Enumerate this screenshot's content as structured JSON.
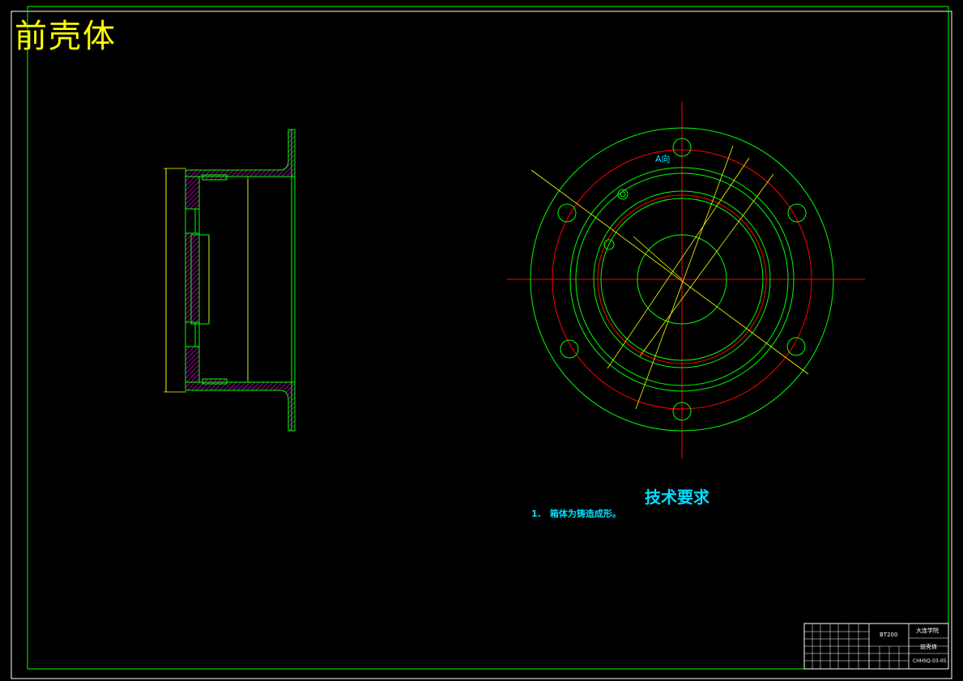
{
  "drawing_title": "前壳体",
  "view_label": "A向",
  "technical_requirements": {
    "title": "技术要求",
    "items": [
      "1.　箱体为铸造成形。"
    ]
  },
  "title_block": {
    "school": "大连学院",
    "part_name": "前壳体",
    "model": "BT200",
    "drawing_no": "CHHSQ-03-05"
  },
  "colors": {
    "background": "#000000",
    "frame": "#00ff00",
    "section": "#ff00ff",
    "center_line": "#ff0000",
    "dimension": "#ffff00",
    "text": "#00e0ff",
    "title": "#ffff00"
  }
}
